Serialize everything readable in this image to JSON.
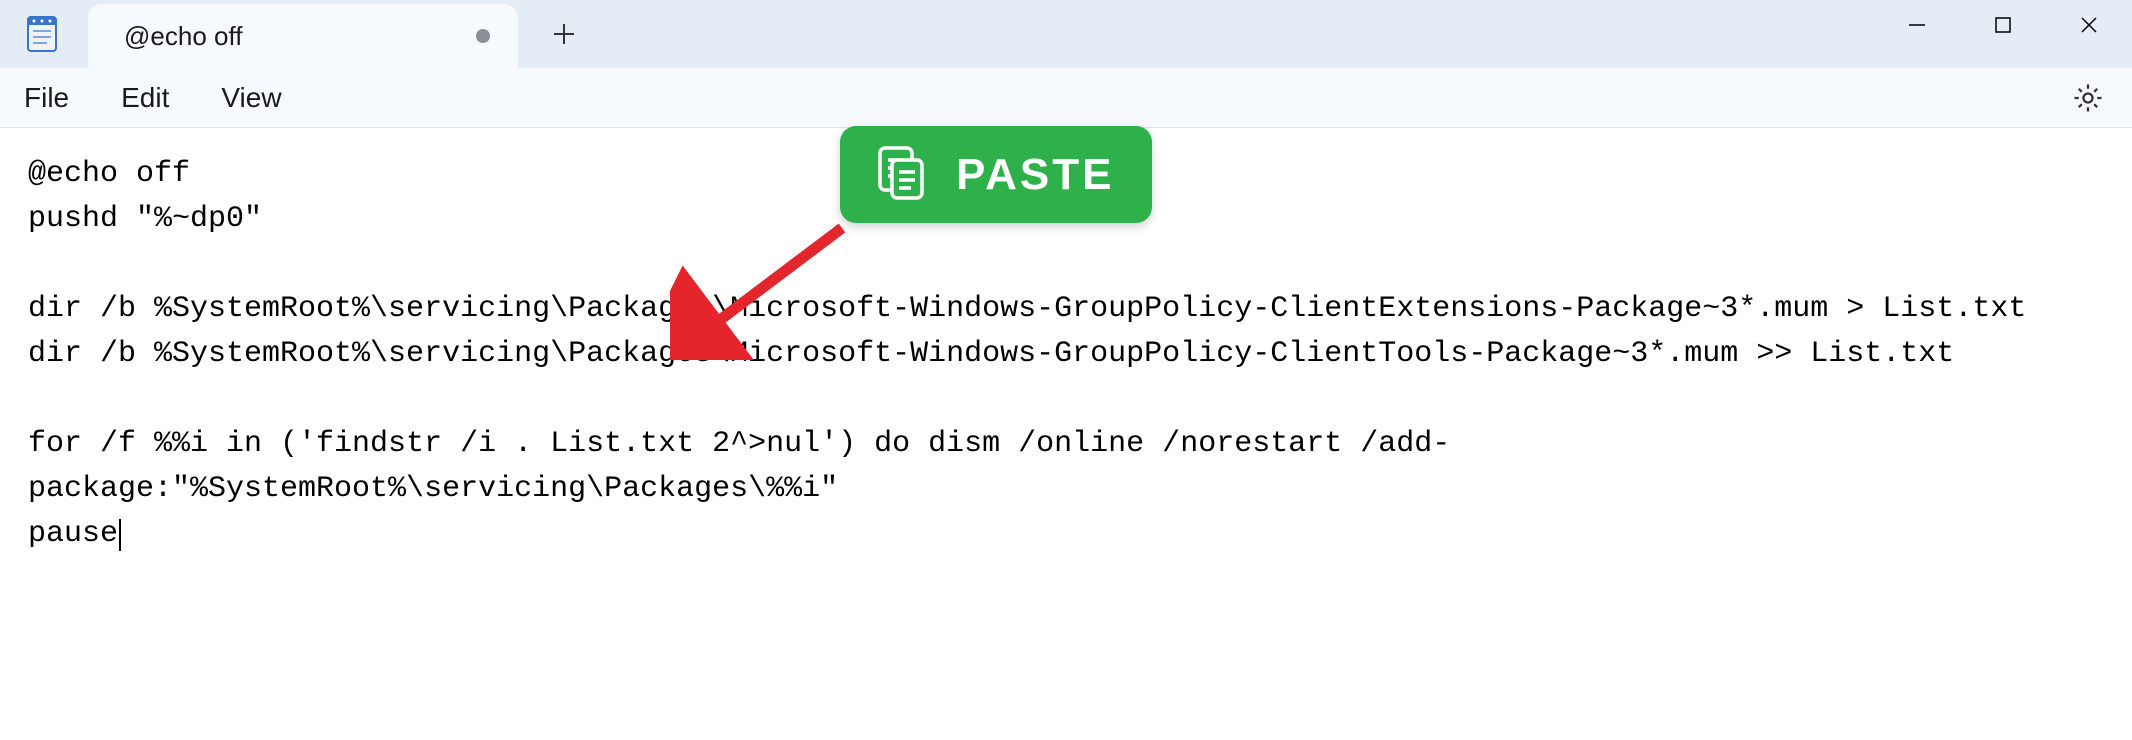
{
  "tab": {
    "title": "@echo off"
  },
  "menu": {
    "file": "File",
    "edit": "Edit",
    "view": "View"
  },
  "badge": {
    "label": "PASTE"
  },
  "editor": {
    "content": "@echo off\npushd \"%~dp0\"\n\ndir /b %SystemRoot%\\servicing\\Packages\\Microsoft-Windows-GroupPolicy-ClientExtensions-Package~3*.mum > List.txt\ndir /b %SystemRoot%\\servicing\\Packages\\Microsoft-Windows-GroupPolicy-ClientTools-Package~3*.mum >> List.txt\n\nfor /f %%i in ('findstr /i . List.txt 2^>nul') do dism /online /norestart /add-package:\"%SystemRoot%\\servicing\\Packages\\%%i\"\npause"
  }
}
